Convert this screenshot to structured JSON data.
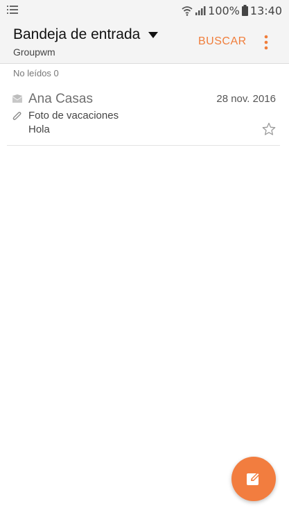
{
  "status_bar": {
    "battery": "100%",
    "time": "13:40",
    "icons": [
      "notification-list-icon",
      "wifi-icon",
      "signal-icon",
      "battery-icon"
    ]
  },
  "header": {
    "folder": "Bandeja de entrada",
    "account": "Groupwm",
    "search_label": "BUSCAR",
    "accent_color": "#f07d3a"
  },
  "list": {
    "unread_header": "No leídos 0",
    "items": [
      {
        "sender": "Ana Casas",
        "date": "28 nov. 2016",
        "subject": "Foto de vacaciones",
        "preview": "Hola",
        "has_attachment": true,
        "starred": false
      }
    ]
  },
  "fab": {
    "icon": "compose-icon",
    "color": "#f27d3f"
  }
}
